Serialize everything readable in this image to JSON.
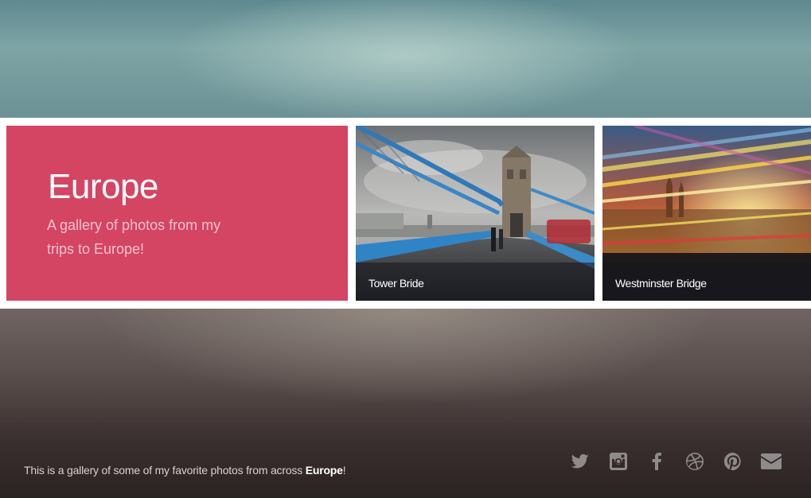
{
  "gallery": {
    "title": "Europe",
    "description": "A gallery of photos from my trips to Europe!"
  },
  "photos": [
    {
      "caption": "Tower Bride"
    },
    {
      "caption": "Westminster Bridge"
    }
  ],
  "footer": {
    "text_before": "This is a gallery of some of my favorite photos from across ",
    "text_emphasis": "Europe",
    "text_after": "!"
  },
  "social": {
    "icons": [
      "twitter-icon",
      "instagram-icon",
      "facebook-icon",
      "dribbble-icon",
      "pinterest-icon",
      "envelope-icon"
    ]
  },
  "colors": {
    "accent": "#d44563",
    "caption_overlay": "rgba(20,22,30,0.55)",
    "icon_gray": "#8f8b8b"
  }
}
